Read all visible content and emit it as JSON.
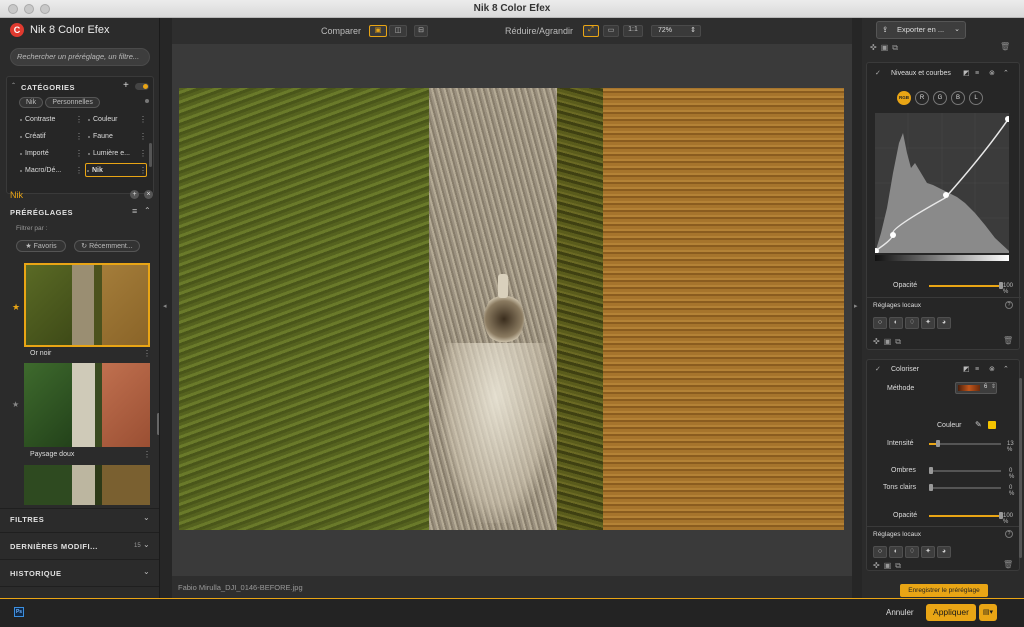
{
  "window": {
    "title": "Nik 8 Color Efex"
  },
  "app": {
    "name": "Nik 8 Color Efex"
  },
  "left": {
    "search_placeholder": "Rechercher un préréglage, un filtre...",
    "categories_title": "CATÉGORIES",
    "tabs": [
      "Nik",
      "Personnelles"
    ],
    "categories": [
      {
        "label": "Contraste"
      },
      {
        "label": "Couleur"
      },
      {
        "label": "Créatif"
      },
      {
        "label": "Faune"
      },
      {
        "label": "Importé"
      },
      {
        "label": "Lumière e..."
      },
      {
        "label": "Macro/Dé..."
      },
      {
        "label": "Nik"
      }
    ],
    "selected_category": "Nik",
    "presets_title": "PRÉRÉGLAGES",
    "filter_by": "Filtrer par :",
    "filter_favorites": "★ Favoris",
    "filter_recent": "↻ Récemment...",
    "presets": [
      {
        "label": "Or noir",
        "favorite": true
      },
      {
        "label": "Paysage doux",
        "favorite": false
      }
    ],
    "sections": [
      {
        "label": "FILTRES",
        "count": ""
      },
      {
        "label": "DERNIÈRES MODIFI...",
        "count": "15"
      },
      {
        "label": "HISTORIQUE",
        "count": ""
      }
    ]
  },
  "toolbar": {
    "compare_label": "Comparer",
    "zoom_label": "Réduire/Agrandir",
    "zoom_one": "1:1",
    "zoom_value": "72%"
  },
  "image": {
    "filename": "Fabio Mirulla_DJI_0146-BEFORE.jpg"
  },
  "right": {
    "export_label": "Exporter en ...",
    "levels": {
      "title": "Niveaux et courbes",
      "channels": [
        "RGB",
        "R",
        "G",
        "B",
        "L"
      ],
      "opacity_label": "Opacité",
      "opacity_value": "100 %",
      "opacity": 1.0,
      "local_label": "Réglages locaux"
    },
    "colorize": {
      "title": "Coloriser",
      "method_label": "Méthode",
      "method_value": "6",
      "color_label": "Couleur",
      "color": "#f5c400",
      "intensity_label": "Intensité",
      "intensity_value": "13 %",
      "intensity": 0.13,
      "shadows_label": "Ombres",
      "shadows_value": "0 %",
      "highlights_label": "Tons clairs",
      "highlights_value": "0 %",
      "opacity_label": "Opacité",
      "opacity_value": "100 %",
      "opacity": 1.0,
      "local_label": "Réglages locaux"
    },
    "save_preset": "Enregistrer le préréglage"
  },
  "bottom": {
    "ps_label": "Ps",
    "cancel": "Annuler",
    "apply": "Appliquer"
  },
  "colors": {
    "accent": "#e9a515",
    "brand": "#e03a2f"
  }
}
